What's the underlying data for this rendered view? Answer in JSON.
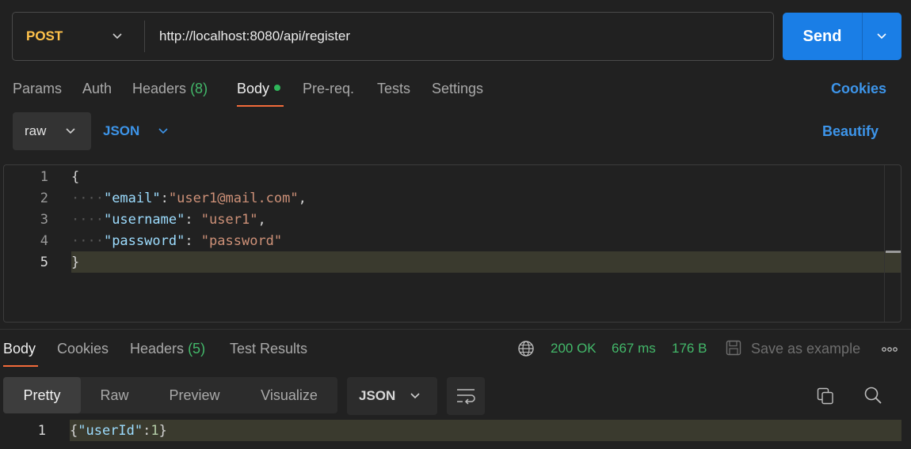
{
  "request": {
    "method": "POST",
    "url": "http://localhost:8080/api/register",
    "send_label": "Send"
  },
  "request_tabs": {
    "params": "Params",
    "auth": "Auth",
    "headers": "Headers",
    "headers_count": "(8)",
    "body": "Body",
    "prereq": "Pre-req.",
    "tests": "Tests",
    "settings": "Settings",
    "cookies": "Cookies"
  },
  "body_mode": {
    "mode": "raw",
    "language": "JSON",
    "beautify": "Beautify"
  },
  "editor": {
    "line_numbers": [
      "1",
      "2",
      "3",
      "4",
      "5"
    ],
    "lines": [
      "{",
      "\"email\":\"user1@mail.com\",",
      "\"username\": \"user1\",",
      "\"password\": \"password\"",
      "}"
    ],
    "keys": [
      "\"email\"",
      "\"username\"",
      "\"password\""
    ],
    "values": [
      "\"user1@mail.com\"",
      "\"user1\"",
      "\"password\""
    ]
  },
  "response_tabs": {
    "body": "Body",
    "cookies": "Cookies",
    "headers": "Headers",
    "headers_count": "(5)",
    "test_results": "Test Results"
  },
  "response_status": {
    "status": "200 OK",
    "time": "667 ms",
    "size": "176 B",
    "save_as_example": "Save as example"
  },
  "response_view": {
    "pretty": "Pretty",
    "raw": "Raw",
    "preview": "Preview",
    "visualize": "Visualize",
    "format": "JSON"
  },
  "response_body": {
    "line_number": "1",
    "open": "{",
    "key": "\"userId\"",
    "colon": ":",
    "value": "1",
    "close": "}"
  },
  "colors": {
    "accent_blue": "#1a7ee6",
    "method_post": "#ffc24b",
    "success_green": "#43b96a",
    "tab_underline": "#f26b3a"
  }
}
